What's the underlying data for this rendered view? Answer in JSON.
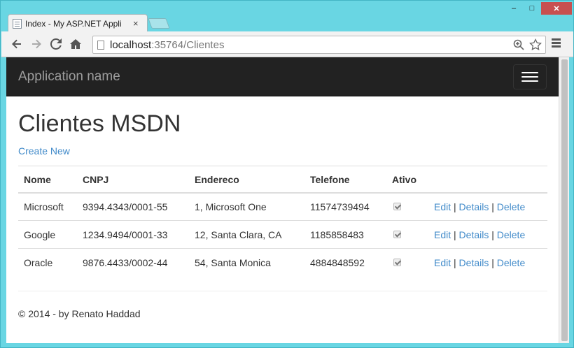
{
  "browser": {
    "tab_title": "Index - My ASP.NET Appli",
    "tab_close": "×",
    "url_host": "localhost",
    "url_rest": ":35764/Clientes",
    "window_controls": {
      "minimize": "–",
      "maximize": "□",
      "close": "✕"
    }
  },
  "navbar": {
    "brand": "Application name"
  },
  "page": {
    "title": "Clientes MSDN",
    "create_link": "Create New"
  },
  "table": {
    "headers": [
      "Nome",
      "CNPJ",
      "Endereco",
      "Telefone",
      "Ativo"
    ],
    "rows": [
      {
        "nome": "Microsoft",
        "cnpj": "9394.4343/0001-55",
        "endereco": "1, Microsoft One",
        "telefone": "11574739494",
        "ativo": true
      },
      {
        "nome": "Google",
        "cnpj": "1234.9494/0001-33",
        "endereco": "12, Santa Clara, CA",
        "telefone": "1185858483",
        "ativo": true
      },
      {
        "nome": "Oracle",
        "cnpj": "9876.4433/0002-44",
        "endereco": "54, Santa Monica",
        "telefone": "4884848592",
        "ativo": true
      }
    ],
    "actions": {
      "edit": "Edit",
      "details": "Details",
      "delete": "Delete",
      "separator": "|"
    }
  },
  "footer": {
    "text": "© 2014 - by Renato Haddad"
  },
  "colors": {
    "navbar_bg": "#222222",
    "link": "#428bca",
    "frame": "#69d6e3"
  }
}
